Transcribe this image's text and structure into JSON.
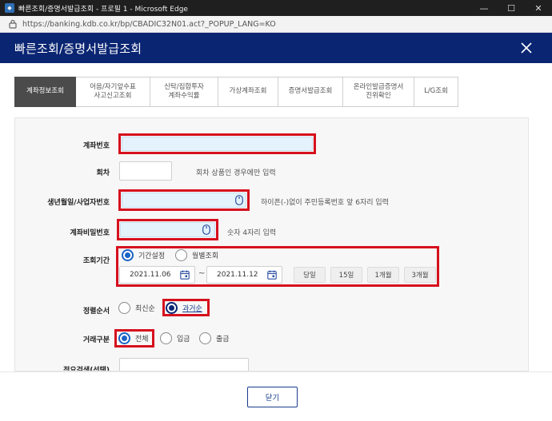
{
  "window": {
    "title": "빠른조회/증명서발급조회 - 프로필 1 - Microsoft Edge",
    "minimize": "—",
    "maximize": "☐",
    "close": "✕"
  },
  "address": {
    "url": "https://banking.kdb.co.kr/bp/CBADIC32N01.act?_POPUP_LANG=KO"
  },
  "header": {
    "title": "빠른조회/증명서발급조회"
  },
  "tabs": [
    {
      "line1": "계좌정보조회",
      "line2": ""
    },
    {
      "line1": "어음/자기앞수표",
      "line2": "사고신고조회"
    },
    {
      "line1": "신탁/집합투자",
      "line2": "계좌수익률"
    },
    {
      "line1": "가상계좌조회",
      "line2": ""
    },
    {
      "line1": "증명서발급조회",
      "line2": ""
    },
    {
      "line1": "온라인발급증명서",
      "line2": "진위확인"
    },
    {
      "line1": "L/G조회",
      "line2": ""
    }
  ],
  "form": {
    "account_number_label": "계좌번호",
    "installment_label": "회차",
    "installment_hint": "회차 상품인 경우에만 입력",
    "birthdate_label": "생년월일/사업자번호",
    "birthdate_hint": "하이픈(-)없이 주민등록번호 앞 6자리 입력",
    "password_label": "계좌비밀번호",
    "password_hint": "숫자 4자리 입력",
    "period_label": "조회기간",
    "period_options": [
      "기간설정",
      "월별조회"
    ],
    "start_date": "2021.11.06",
    "tilde": "~",
    "end_date": "2021.11.12",
    "quick_ranges": [
      "당일",
      "15일",
      "1개월",
      "3개월"
    ],
    "order_label": "정렬순서",
    "order_options": [
      "최신순",
      "과거순"
    ],
    "type_label": "거래구분",
    "type_options": [
      "전체",
      "입금",
      "출금"
    ],
    "memo_label": "적요검색(선택)"
  },
  "footer": {
    "close_label": "닫기"
  },
  "colors": {
    "header_bg": "#0a2572",
    "highlight": "#d6101d",
    "radio_selected": "#1a63c6",
    "active_tab": "#4b4b4b"
  }
}
